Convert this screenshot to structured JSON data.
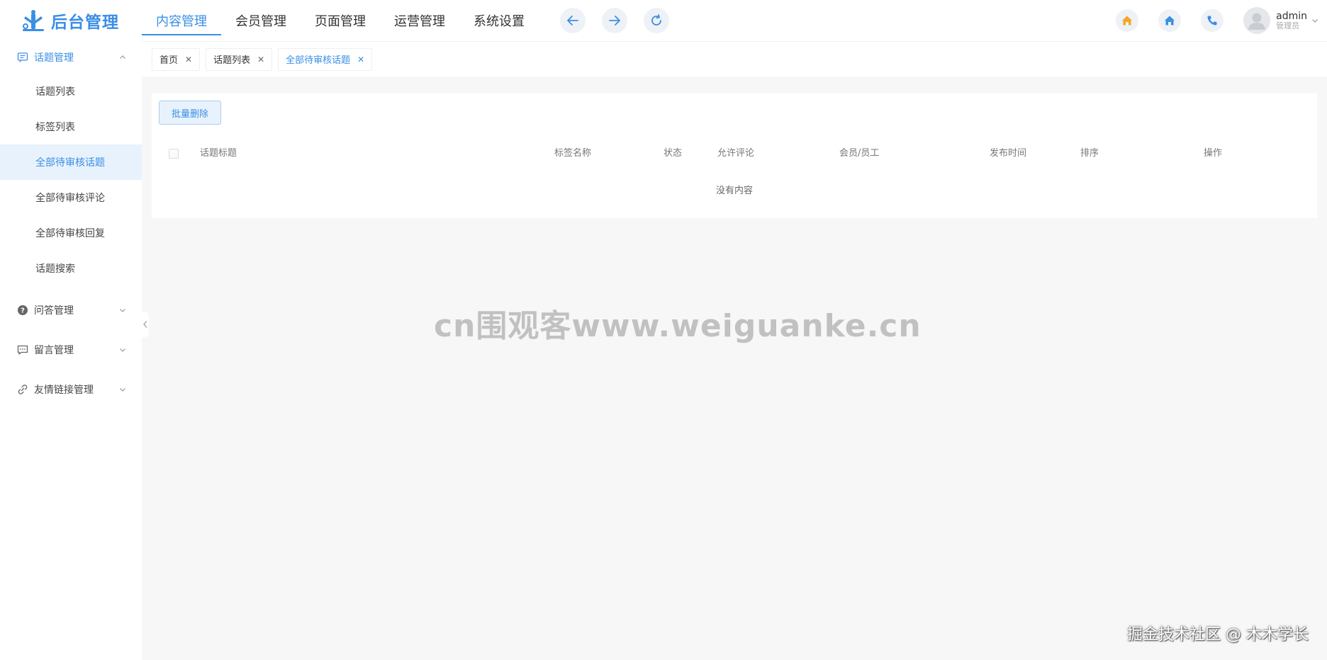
{
  "header": {
    "logo_text": "后台管理",
    "nav": [
      {
        "label": "内容管理",
        "active": true
      },
      {
        "label": "会员管理",
        "active": false
      },
      {
        "label": "页面管理",
        "active": false
      },
      {
        "label": "运营管理",
        "active": false
      },
      {
        "label": "系统设置",
        "active": false
      }
    ],
    "user": {
      "name": "admin",
      "role": "管理员"
    },
    "accent": "#3a8ee6"
  },
  "sidebar": {
    "groups": [
      {
        "label": "话题管理",
        "icon": "chat-icon",
        "open": true,
        "items": [
          "话题列表",
          "标签列表",
          "全部待审核话题",
          "全部待审核评论",
          "全部待审核回复",
          "话题搜索"
        ],
        "active_item": 2
      },
      {
        "label": "问答管理",
        "icon": "question-icon",
        "open": false
      },
      {
        "label": "留言管理",
        "icon": "message-icon",
        "open": false
      },
      {
        "label": "友情链接管理",
        "icon": "link-icon",
        "open": false
      }
    ]
  },
  "tabs": [
    {
      "label": "首页",
      "active": false
    },
    {
      "label": "话题列表",
      "active": false
    },
    {
      "label": "全部待审核话题",
      "active": true
    }
  ],
  "content": {
    "batch_delete": "批量删除",
    "columns": [
      "话题标题",
      "标签名称",
      "状态",
      "允许评论",
      "会员/员工",
      "发布时间",
      "排序",
      "操作"
    ],
    "empty_text": "没有内容"
  },
  "watermarks": {
    "center": "cn围观客www.weiguanke.cn",
    "bottom": "掘金技术社区 @ 木木学长"
  }
}
